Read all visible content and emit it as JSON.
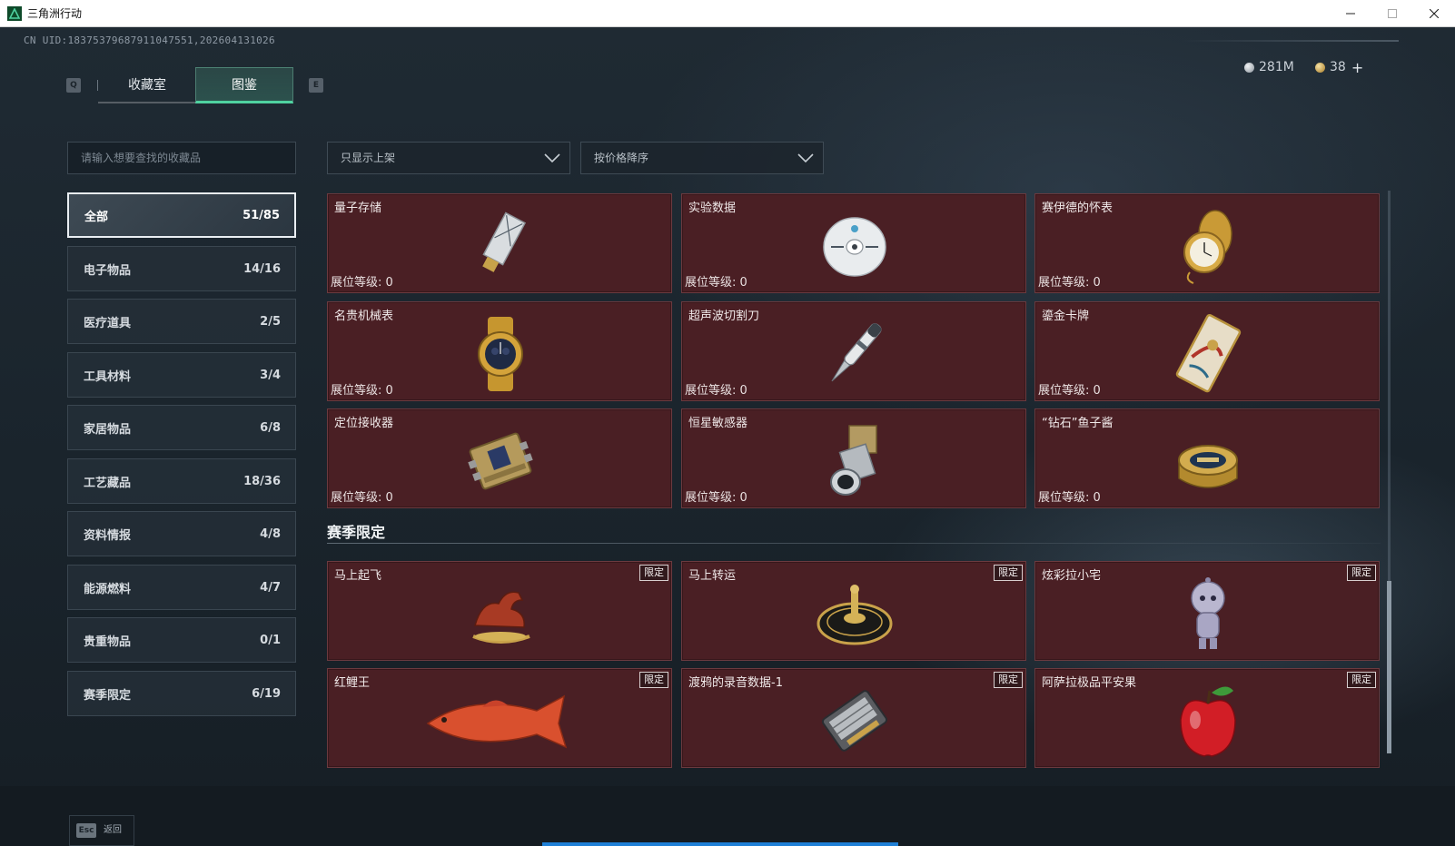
{
  "window": {
    "title": "三角洲行动",
    "controls": [
      "minimize-icon",
      "maximize-icon",
      "close-icon"
    ]
  },
  "header": {
    "uid": "CN UID:18375379687911047551,202604131026",
    "currency": [
      {
        "icon": "silver-coin-icon",
        "value": "281M"
      },
      {
        "icon": "gold-coin-icon",
        "value": "38"
      }
    ],
    "add_label": "+"
  },
  "tabs": {
    "prev_key": "Q",
    "next_key": "E",
    "items": [
      {
        "label": "收藏室",
        "active": false
      },
      {
        "label": "图鉴",
        "active": true
      }
    ]
  },
  "search": {
    "placeholder": "请输入想要查找的收藏品"
  },
  "categories": [
    {
      "label": "全部",
      "count": "51/85",
      "active": true
    },
    {
      "label": "电子物品",
      "count": "14/16"
    },
    {
      "label": "医疗道具",
      "count": "2/5"
    },
    {
      "label": "工具材料",
      "count": "3/4"
    },
    {
      "label": "家居物品",
      "count": "6/8"
    },
    {
      "label": "工艺藏品",
      "count": "18/36"
    },
    {
      "label": "资料情报",
      "count": "4/8"
    },
    {
      "label": "能源燃料",
      "count": "4/7"
    },
    {
      "label": "贵重物品",
      "count": "0/1"
    },
    {
      "label": "赛季限定",
      "count": "6/19"
    }
  ],
  "filters": {
    "show_filter": "只显示上架",
    "sort": "按价格降序"
  },
  "items": [
    {
      "name": "量子存储",
      "level": "展位等级: 0",
      "icon": "usb-drive-icon"
    },
    {
      "name": "实验数据",
      "level": "展位等级: 0",
      "icon": "disc-icon"
    },
    {
      "name": "赛伊德的怀表",
      "level": "展位等级: 0",
      "icon": "pocket-watch-icon"
    },
    {
      "name": "名贵机械表",
      "level": "展位等级: 0",
      "icon": "wristwatch-icon"
    },
    {
      "name": "超声波切割刀",
      "level": "展位等级: 0",
      "icon": "cutting-knife-icon"
    },
    {
      "name": "鎏金卡牌",
      "level": "展位等级: 0",
      "icon": "gilded-card-icon"
    },
    {
      "name": "定位接收器",
      "level": "展位等级: 0",
      "icon": "gps-receiver-icon"
    },
    {
      "name": "恒星敏感器",
      "level": "展位等级: 0",
      "icon": "star-sensor-icon"
    },
    {
      "name": "“钻石”鱼子酱",
      "level": "展位等级: 0",
      "icon": "caviar-tin-icon"
    }
  ],
  "season": {
    "title": "赛季限定",
    "badge": "限定",
    "items": [
      {
        "name": "马上起飞",
        "icon": "horse-statue-icon"
      },
      {
        "name": "马上转运",
        "icon": "golden-wheel-icon"
      },
      {
        "name": "炫彩拉小宅",
        "icon": "doll-figure-icon"
      },
      {
        "name": "红鲤王",
        "icon": "carp-fish-icon"
      },
      {
        "name": "渡鸦的录音数据-1",
        "icon": "tape-recorder-icon"
      },
      {
        "name": "阿萨拉极品平安果",
        "icon": "apple-icon"
      }
    ]
  },
  "footer": {
    "esc_key": "Esc",
    "back_label": "返回"
  }
}
